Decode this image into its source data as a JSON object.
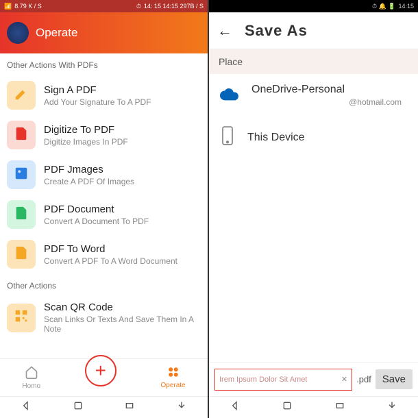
{
  "left": {
    "status": {
      "net": "8.79 K / S",
      "time": "14: 15 14:15 297B / S"
    },
    "header": {
      "title": "Operate"
    },
    "section1": "Other Actions With PDFs",
    "items": [
      {
        "title": "Sign A PDF",
        "sub": "Add Your Signature To A PDF"
      },
      {
        "title": "Digitize To PDF",
        "sub": "Digitize Images In PDF"
      },
      {
        "title": "PDF Jmages",
        "sub": "Create A PDF Of Images"
      },
      {
        "title": "PDF Document",
        "sub": "Convert A Document To PDF"
      },
      {
        "title": "PDF To Word",
        "sub": "Convert A PDF To A Word Document"
      }
    ],
    "section2": "Other Actions",
    "items2": [
      {
        "title": "Scan QR Code",
        "sub": "Scan Links Or Texts And Save Them In A Note"
      }
    ],
    "nav": {
      "home": "Homo",
      "operate": "Operate"
    }
  },
  "right": {
    "status": {
      "time": "14:15"
    },
    "header": {
      "title": "Save As"
    },
    "place_label": "Place",
    "places": [
      {
        "title": "OneDrive-Personal",
        "sub": "@hotmail.com"
      },
      {
        "title": "This Device",
        "sub": ""
      }
    ],
    "filename": "Irem Ipsum Dolor Sit Amet",
    "ext": ".pdf",
    "save": "Save"
  }
}
